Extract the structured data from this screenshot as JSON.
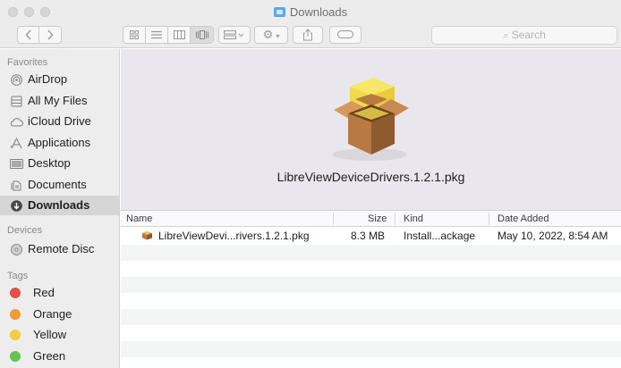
{
  "window": {
    "title": "Downloads",
    "title_icon": "downloads-folder-icon"
  },
  "toolbar": {
    "back_icon": "chevron-left-icon",
    "forward_icon": "chevron-right-icon",
    "view_icons": [
      "icon-view-icon",
      "list-view-icon",
      "column-view-icon",
      "cover-flow-view-icon"
    ],
    "group_icon": "group-by-icon",
    "action_icon": "gear-icon",
    "share_icon": "share-icon",
    "tag_icon": "tag-icon",
    "search_placeholder": "Search",
    "search_icon": "search-icon"
  },
  "sidebar": {
    "favorites_title": "Favorites",
    "favorites": [
      {
        "label": "AirDrop",
        "icon": "airdrop-icon"
      },
      {
        "label": "All My Files",
        "icon": "all-my-files-icon"
      },
      {
        "label": "iCloud Drive",
        "icon": "cloud-icon"
      },
      {
        "label": "Applications",
        "icon": "applications-icon"
      },
      {
        "label": "Desktop",
        "icon": "desktop-icon"
      },
      {
        "label": "Documents",
        "icon": "documents-icon"
      },
      {
        "label": "Downloads",
        "icon": "downloads-icon",
        "active": true
      }
    ],
    "devices_title": "Devices",
    "devices": [
      {
        "label": "Remote Disc",
        "icon": "disc-icon"
      }
    ],
    "tags_title": "Tags",
    "tags": [
      {
        "label": "Red",
        "color": "#e2514a"
      },
      {
        "label": "Orange",
        "color": "#f09a37"
      },
      {
        "label": "Yellow",
        "color": "#f5cd3f"
      },
      {
        "label": "Green",
        "color": "#62c554"
      }
    ]
  },
  "preview": {
    "filename": "LibreViewDeviceDrivers.1.2.1.pkg",
    "icon": "package-box-icon"
  },
  "list": {
    "columns": {
      "name": "Name",
      "size": "Size",
      "kind": "Kind",
      "date_added": "Date Added"
    },
    "rows": [
      {
        "name": "LibreViewDevi...rivers.1.2.1.pkg",
        "size": "8.3 MB",
        "kind": "Install...ackage",
        "date_added": "May 10, 2022, 8:54 AM",
        "icon": "package-icon"
      }
    ]
  }
}
